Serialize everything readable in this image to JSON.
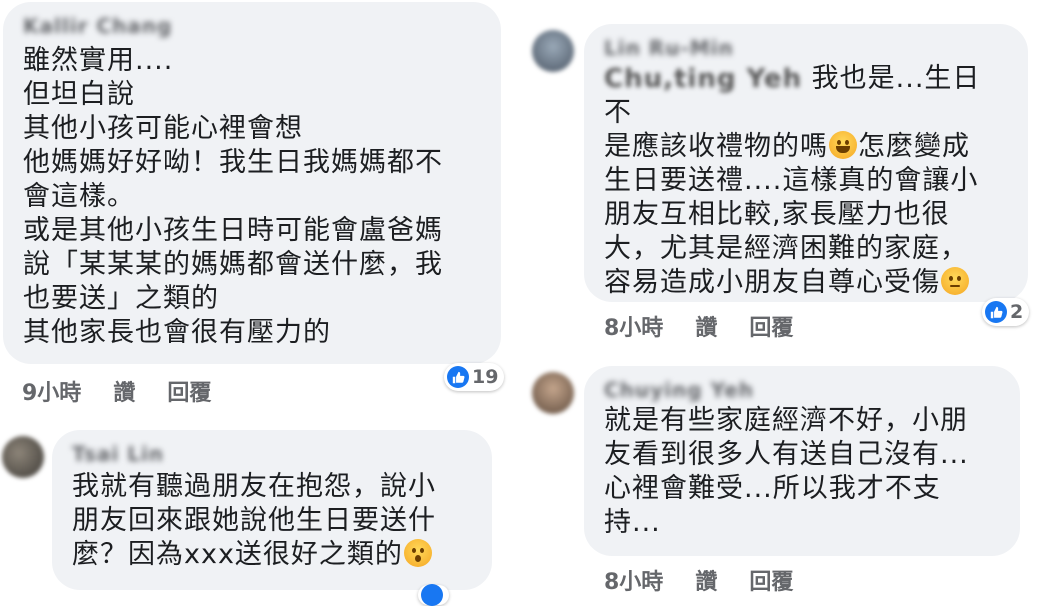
{
  "comments": [
    {
      "author": "Kallir Chang",
      "text": "雖然實用....\n但坦白說\n其他小孩可能心裡會想\n他媽媽好好呦！我生日我媽媽都不\n會這樣。\n或是其他小孩生日時可能會盧爸媽\n說「某某某的媽媽都會送什麼，我\n也要送」之類的\n其他家長也會很有壓力的",
      "time": "9小時",
      "like": "讚",
      "reply": "回覆",
      "reactions": "19"
    },
    {
      "author": "Tsai Lin",
      "text_part1": "我就有聽過朋友在抱怨，說小\n朋友回來跟她說他生日要送什\n麼？因為xxx送很好之類的",
      "emoji": "hushed-face-emoji"
    },
    {
      "author": "Lin Ru-Min",
      "mention": "Chu,ting Yeh",
      "text_part1": " 我也是...生日不\n是應該收禮物的嗎",
      "emoji1": "laughing-tears-emoji",
      "text_part2": "怎麼變成\n生日要送禮....這樣真的會讓小\n朋友互相比較,家長壓力也很\n大，尤其是經濟困難的家庭，\n容易造成小朋友自尊心受傷",
      "emoji2": "persevering-face-emoji",
      "time": "8小時",
      "like": "讚",
      "reply": "回覆",
      "reactions": "2"
    },
    {
      "author": "Chuying Yeh",
      "text": "就是有些家庭經濟不好，小朋\n友看到很多人有送自己沒有...\n心裡會難受...所以我才不支\n持...",
      "time": "8小時",
      "like": "讚",
      "reply": "回覆"
    }
  ],
  "colors": {
    "bubble": "#f0f2f5",
    "like_blue": "#1877f2",
    "meta_gray": "#65676b"
  }
}
